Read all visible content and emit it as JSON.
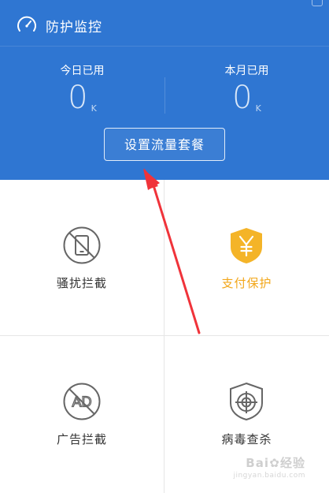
{
  "app": {
    "accent_color": "#2f76d2",
    "gold_color": "#f2a71b"
  },
  "header": {
    "title": "防护监控",
    "icon": "gauge-icon"
  },
  "stats": {
    "today": {
      "label": "今日已用",
      "value": "0",
      "unit": "K"
    },
    "month": {
      "label": "本月已用",
      "value": "0",
      "unit": "K"
    }
  },
  "plan_button": {
    "label": "设置流量套餐"
  },
  "features": [
    {
      "label": "骚扰拦截",
      "icon": "blocked-phone-icon"
    },
    {
      "label": "支付保护",
      "icon": "yuan-shield-icon"
    },
    {
      "label": "广告拦截",
      "icon": "blocked-ad-icon"
    },
    {
      "label": "病毒查杀",
      "icon": "virus-target-shield-icon"
    }
  ],
  "watermark": {
    "text": "Bai",
    "text2": "经验",
    "sub": "jingyan.baidu.com"
  }
}
